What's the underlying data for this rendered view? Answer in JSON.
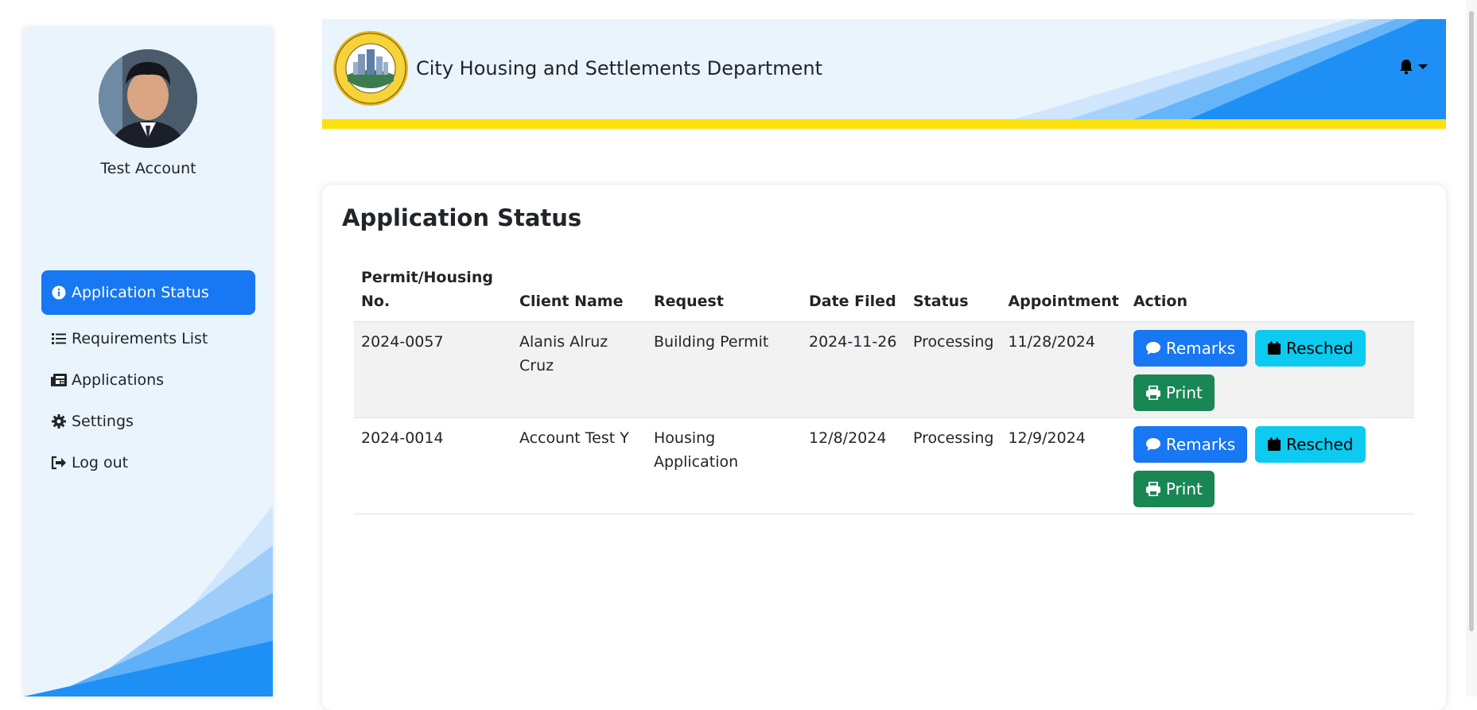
{
  "user": {
    "name": "Test Account"
  },
  "nav": {
    "items": [
      {
        "label": "Application Status",
        "icon": "info-circle-icon",
        "active": true
      },
      {
        "label": "Requirements List",
        "icon": "list-icon",
        "active": false
      },
      {
        "label": "Applications",
        "icon": "newspaper-icon",
        "active": false
      },
      {
        "label": "Settings",
        "icon": "gear-icon",
        "active": false
      },
      {
        "label": "Log out",
        "icon": "sign-out-icon",
        "active": false
      }
    ]
  },
  "header": {
    "title": "City Housing and Settlements Department"
  },
  "main": {
    "title": "Application Status",
    "columns": [
      "Permit/Housing No.",
      "Client Name",
      "Request",
      "Date Filed",
      "Status",
      "Appointment",
      "Action"
    ],
    "rows": [
      {
        "no": "2024-0057",
        "client": "Alanis Alruz Cruz",
        "request": "Building Permit",
        "date_filed": "2024-11-26",
        "status": "Processing",
        "appointment": "11/28/2024"
      },
      {
        "no": "2024-0014",
        "client": "Account Test Y",
        "request": "Housing Application",
        "date_filed": "12/8/2024",
        "status": "Processing",
        "appointment": "12/9/2024"
      }
    ],
    "actions": {
      "remarks": "Remarks",
      "resched": "Resched",
      "print": "Print"
    }
  },
  "colors": {
    "primary": "#1877f2",
    "info": "#0dcaf0",
    "success": "#198754",
    "stripe": "#fbe10b",
    "panel_bg": "#eaf4fd"
  }
}
